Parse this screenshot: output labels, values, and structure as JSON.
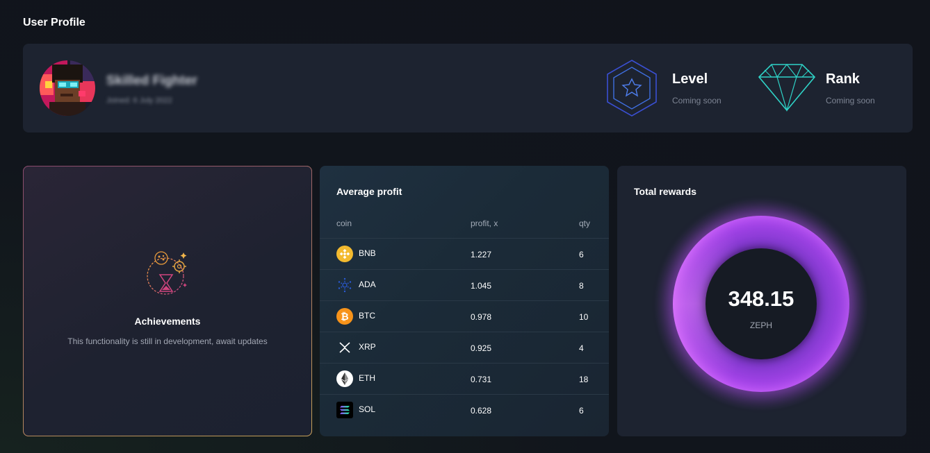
{
  "page": {
    "title": "User Profile"
  },
  "profile": {
    "name": "Skilled Fighter",
    "joined": "Joined: 6 July 2022"
  },
  "stats": [
    {
      "title": "Level",
      "subtitle": "Coming soon",
      "icon": "star-hexagon-icon"
    },
    {
      "title": "Rank",
      "subtitle": "Coming soon",
      "icon": "diamond-icon"
    }
  ],
  "achievements": {
    "title": "Achievements",
    "description": "This functionality is still in development, await updates",
    "icon": "achievements-hourglass-icon"
  },
  "average_profit": {
    "title": "Average profit",
    "columns": {
      "coin": "coin",
      "profit": "profit, x",
      "qty": "qty"
    },
    "rows": [
      {
        "coin": "BNB",
        "profit": "1.227",
        "qty": "6",
        "icon": "bnb-icon",
        "color": "#f3ba2f"
      },
      {
        "coin": "ADA",
        "profit": "1.045",
        "qty": "8",
        "icon": "ada-icon",
        "color": "#2a5bd7"
      },
      {
        "coin": "BTC",
        "profit": "0.978",
        "qty": "10",
        "icon": "btc-icon",
        "color": "#f7931a"
      },
      {
        "coin": "XRP",
        "profit": "0.925",
        "qty": "4",
        "icon": "xrp-icon",
        "color": "#ffffff"
      },
      {
        "coin": "ETH",
        "profit": "0.731",
        "qty": "18",
        "icon": "eth-icon",
        "color": "#ffffff"
      },
      {
        "coin": "SOL",
        "profit": "0.628",
        "qty": "6",
        "icon": "sol-icon",
        "color": "#14f195"
      }
    ]
  },
  "rewards": {
    "title": "Total rewards",
    "value": "348.15",
    "unit": "ZEPH"
  },
  "colors": {
    "background": "#11151c",
    "card": "#1d2330",
    "accent_purple": "#b047f2",
    "accent_pink": "#e35bf5",
    "rank_teal": "#2fd3c7",
    "level_blue": "#3b5bd6"
  }
}
